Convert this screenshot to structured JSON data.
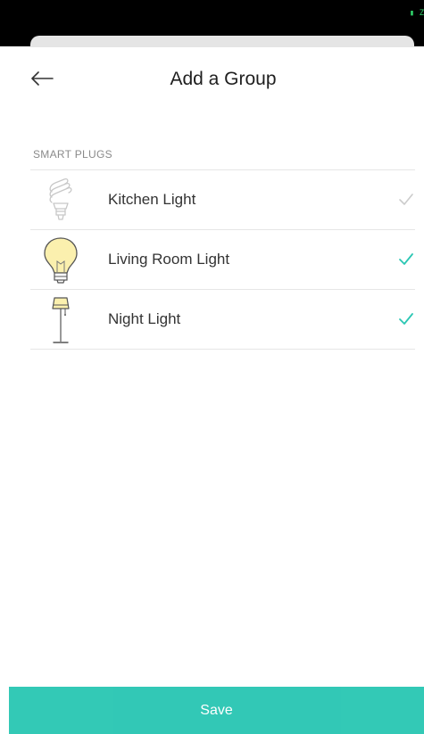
{
  "status_bar": {
    "battery_text": "■ ■"
  },
  "header": {
    "title": "Add a Group",
    "back_icon": "back-arrow-icon"
  },
  "section": {
    "label": "SMART PLUGS"
  },
  "devices": [
    {
      "label": "Kitchen Light",
      "icon": "cfl-bulb-icon",
      "checked": false
    },
    {
      "label": "Living Room Light",
      "icon": "light-bulb-icon",
      "checked": true
    },
    {
      "label": "Night Light",
      "icon": "floor-lamp-icon",
      "checked": true
    }
  ],
  "footer": {
    "save_label": "Save"
  },
  "colors": {
    "accent": "#2cc7b4",
    "check_on": "#2cc7b4",
    "check_off": "#cccccc",
    "bulb_fill": "#fbf0ae",
    "title": "#1f1f1f"
  }
}
